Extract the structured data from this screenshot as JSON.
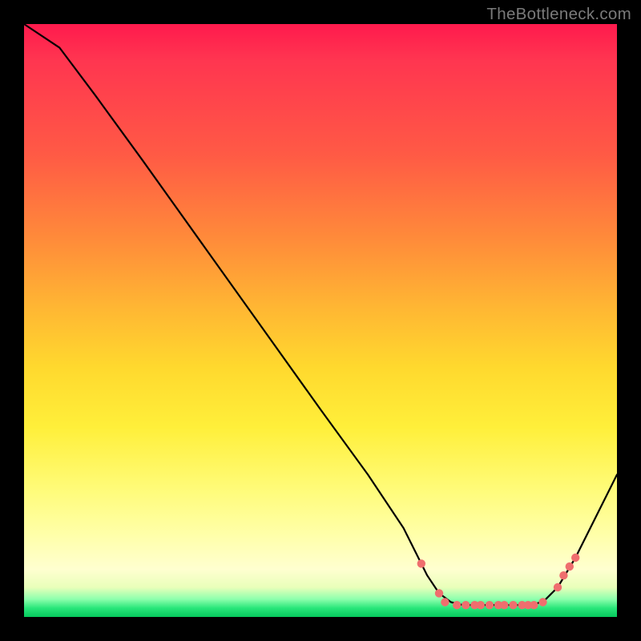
{
  "watermark": "TheBottleneck.com",
  "colors": {
    "frame_bg": "#000000",
    "curve_stroke": "#000000",
    "dot_fill": "#ef6e6e",
    "gradient_top": "#ff1a4d",
    "gradient_bottom": "#06c95d"
  },
  "chart_data": {
    "type": "line",
    "title": "",
    "xlabel": "",
    "ylabel": "",
    "xlim": [
      0,
      100
    ],
    "ylim": [
      0,
      100
    ],
    "grid": false,
    "curve": [
      {
        "x": 0,
        "y": 100
      },
      {
        "x": 6,
        "y": 96
      },
      {
        "x": 12,
        "y": 88
      },
      {
        "x": 20,
        "y": 77
      },
      {
        "x": 30,
        "y": 63
      },
      {
        "x": 40,
        "y": 49
      },
      {
        "x": 50,
        "y": 35
      },
      {
        "x": 58,
        "y": 24
      },
      {
        "x": 64,
        "y": 15
      },
      {
        "x": 66,
        "y": 11
      },
      {
        "x": 68,
        "y": 7
      },
      {
        "x": 70,
        "y": 4
      },
      {
        "x": 72,
        "y": 2.5
      },
      {
        "x": 74,
        "y": 2
      },
      {
        "x": 78,
        "y": 2
      },
      {
        "x": 82,
        "y": 2
      },
      {
        "x": 86,
        "y": 2
      },
      {
        "x": 88,
        "y": 3
      },
      {
        "x": 90,
        "y": 5
      },
      {
        "x": 93,
        "y": 10
      },
      {
        "x": 96,
        "y": 16
      },
      {
        "x": 100,
        "y": 24
      }
    ],
    "dots": [
      {
        "x": 67,
        "y": 9
      },
      {
        "x": 70,
        "y": 4
      },
      {
        "x": 71,
        "y": 2.5
      },
      {
        "x": 73,
        "y": 2
      },
      {
        "x": 74.5,
        "y": 2
      },
      {
        "x": 76,
        "y": 2
      },
      {
        "x": 77,
        "y": 2
      },
      {
        "x": 78.5,
        "y": 2
      },
      {
        "x": 80,
        "y": 2
      },
      {
        "x": 81,
        "y": 2
      },
      {
        "x": 82.5,
        "y": 2
      },
      {
        "x": 84,
        "y": 2
      },
      {
        "x": 85,
        "y": 2
      },
      {
        "x": 86,
        "y": 2
      },
      {
        "x": 87.5,
        "y": 2.5
      },
      {
        "x": 90,
        "y": 5
      },
      {
        "x": 91,
        "y": 7
      },
      {
        "x": 92,
        "y": 8.5
      },
      {
        "x": 93,
        "y": 10
      }
    ]
  }
}
